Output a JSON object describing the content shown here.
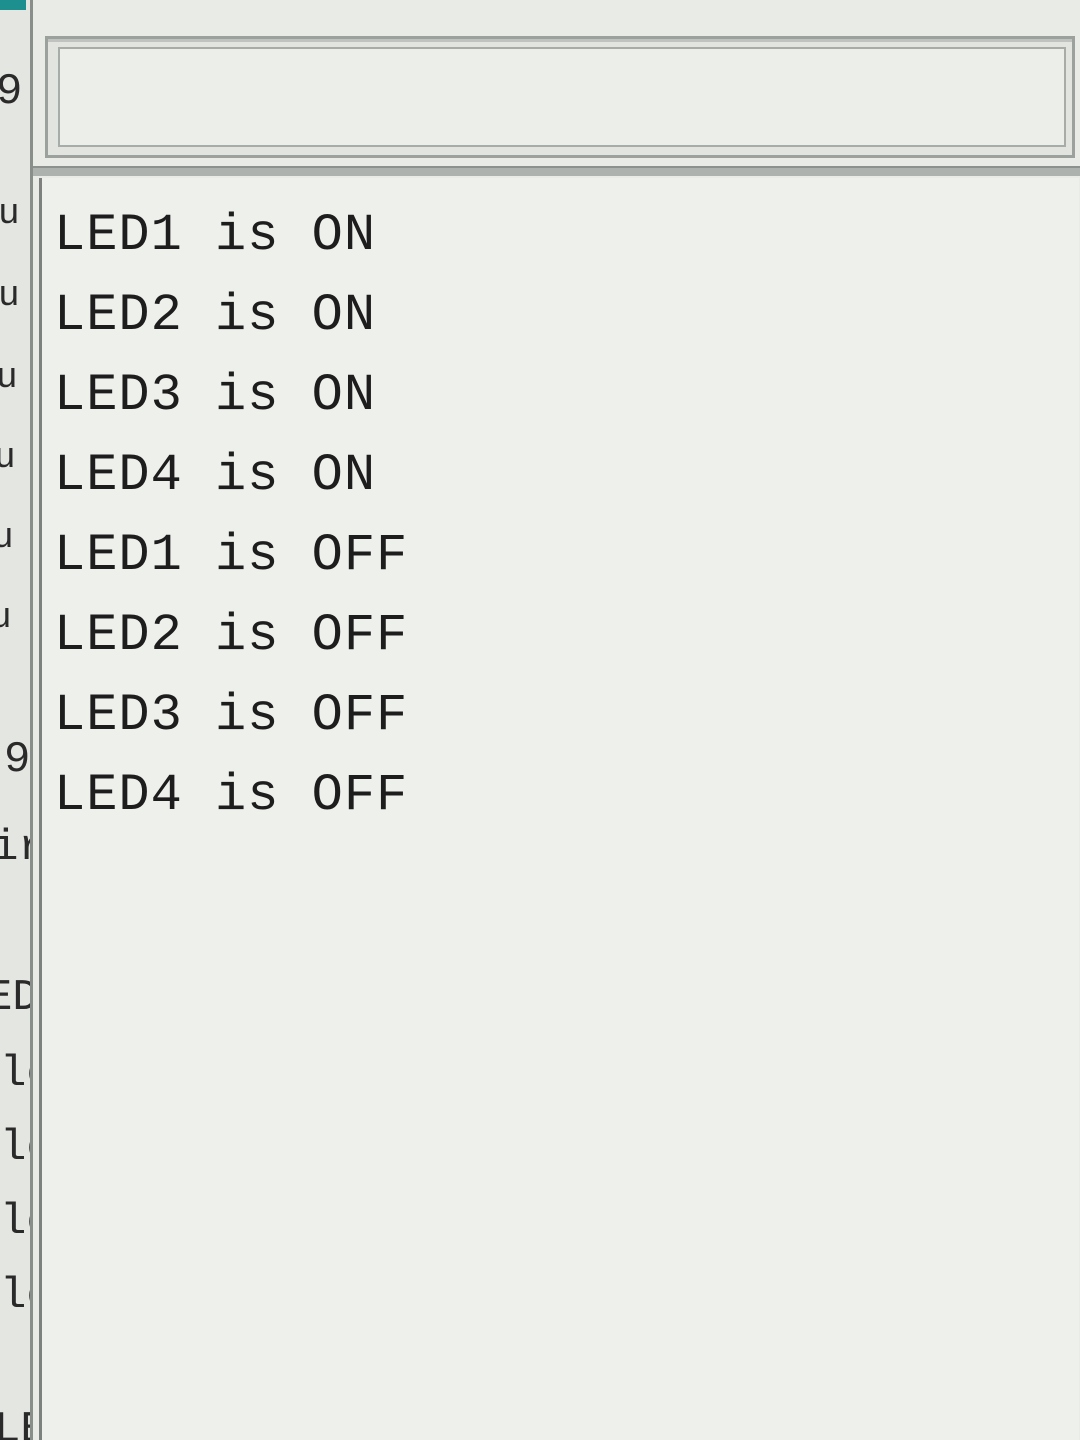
{
  "editor_fragments": [
    "9",
    "u",
    "u",
    "u",
    "u",
    "u",
    "u",
    "9",
    "ir",
    "ED",
    "le",
    "le",
    "le",
    "le",
    "LED"
  ],
  "serial_monitor": {
    "send_value": "",
    "output_lines": [
      "LED1 is ON",
      "LED2 is ON",
      "LED3 is ON",
      "LED4 is ON",
      "LED1 is OFF",
      "LED2 is OFF",
      "LED3 is OFF",
      "LED4 is OFF"
    ]
  },
  "colors": {
    "accent": "#1e8f8f",
    "text": "#1d1d1d",
    "window_bg": "#eef0ec"
  }
}
